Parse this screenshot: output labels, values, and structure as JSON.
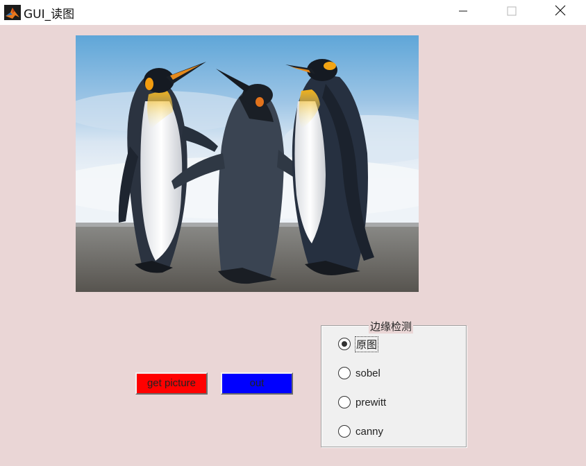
{
  "window": {
    "title": "GUI_读图",
    "app_icon": "matlab-icon",
    "controls": [
      "minimize-icon",
      "maximize-icon",
      "close-icon"
    ]
  },
  "image_display": {
    "content": "photo of three king penguins on a beach"
  },
  "buttons": {
    "get_picture": {
      "label": "get picture",
      "color": "#ff0000"
    },
    "out": {
      "label": "out",
      "color": "#0000ff"
    }
  },
  "edge_panel": {
    "title": "边缘检测",
    "options": [
      {
        "label": "原图",
        "selected": true
      },
      {
        "label": "sobel",
        "selected": false
      },
      {
        "label": "prewitt",
        "selected": false
      },
      {
        "label": "canny",
        "selected": false
      }
    ]
  },
  "colors": {
    "background": "#ead6d6",
    "panel": "#f0f0f0"
  }
}
